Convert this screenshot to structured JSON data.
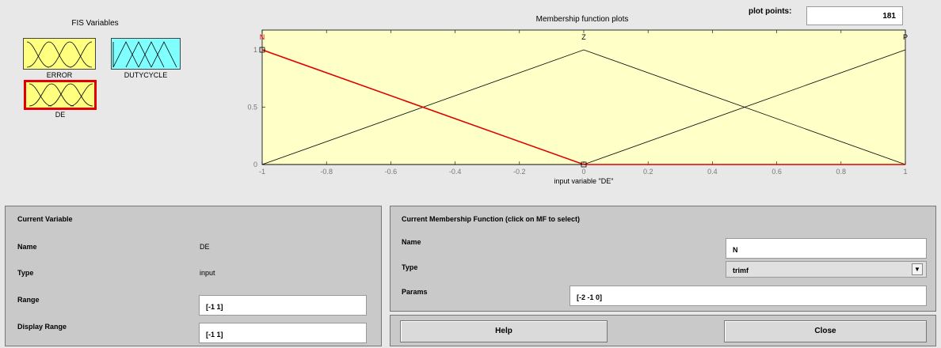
{
  "fis_variables": {
    "title": "FIS Variables",
    "items": [
      {
        "label": "ERROR",
        "color": "#ffff80",
        "selected": false
      },
      {
        "label": "DUTYCYCLE",
        "color": "#80ffff",
        "selected": false
      },
      {
        "label": "DE",
        "color": "#ffff80",
        "selected": true
      }
    ]
  },
  "plot": {
    "title": "Membership function plots",
    "plot_points_label": "plot points:",
    "plot_points_value": "181",
    "xlabel": "input variable \"DE\"",
    "x_ticks": [
      "-1",
      "-0.8",
      "-0.6",
      "-0.4",
      "-0.2",
      "0",
      "0.2",
      "0.4",
      "0.6",
      "0.8",
      "1"
    ],
    "y_ticks": [
      "0",
      "0.5",
      "1"
    ],
    "mf_labels": [
      "N",
      "Z",
      "P"
    ],
    "background": "#ffffc8",
    "selected_color": "#e00000"
  },
  "chart_data": {
    "type": "line",
    "xlabel": "input variable \"DE\"",
    "xlim": [
      -1,
      1
    ],
    "ylim": [
      0,
      1
    ],
    "series": [
      {
        "name": "N",
        "x": [
          -1,
          0,
          1
        ],
        "y": [
          1,
          0,
          0
        ],
        "selected": true
      },
      {
        "name": "Z",
        "x": [
          -1,
          0,
          1
        ],
        "y": [
          0,
          1,
          0
        ],
        "selected": false
      },
      {
        "name": "P",
        "x": [
          -1,
          0,
          1
        ],
        "y": [
          0,
          0,
          1
        ],
        "selected": false
      }
    ]
  },
  "current_variable": {
    "title": "Current Variable",
    "name_label": "Name",
    "name_value": "DE",
    "type_label": "Type",
    "type_value": "input",
    "range_label": "Range",
    "range_value": "[-1 1]",
    "display_range_label": "Display Range",
    "display_range_value": "[-1 1]"
  },
  "current_mf": {
    "title": "Current Membership Function (click on MF to select)",
    "name_label": "Name",
    "name_value": "N",
    "type_label": "Type",
    "type_value": "trimf",
    "params_label": "Params",
    "params_value": "[-2 -1 0]"
  },
  "buttons": {
    "help": "Help",
    "close": "Close"
  }
}
